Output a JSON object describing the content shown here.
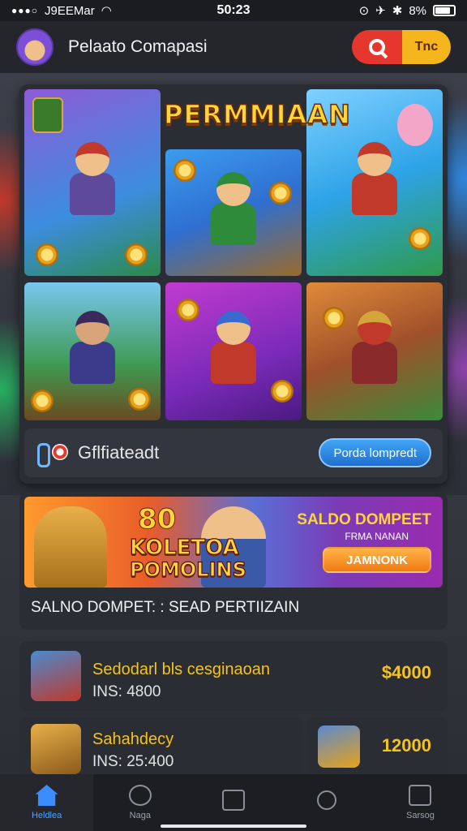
{
  "status_bar": {
    "carrier": "J9EEMar",
    "time": "50:23",
    "battery": "8%"
  },
  "header": {
    "title": "Pelaato Comapasi",
    "tab_label": "Tnc",
    "search_icon": "search-icon",
    "colors": {
      "search": "#e5372e",
      "tab": "#f5b51c"
    }
  },
  "games": {
    "banner_title": "PERMMIAAN",
    "tiles": [
      {
        "badge": ""
      },
      {
        "badge": ""
      },
      {
        "badge": ""
      },
      {
        "badge": ""
      },
      {
        "badge": ""
      },
      {
        "badge": ""
      }
    ],
    "name": "Gflfiateadt",
    "play_label": "Porda lompredt"
  },
  "promo": {
    "big_number": "80",
    "word_1": "KOLETOA",
    "word_2": "POMOLINS",
    "right_title": "SALDO DOMPEET",
    "right_subtitle": "FRMA NANAN",
    "cta_label": "JAMNONK",
    "caption": "SALNO DOMPET: : SEAD PERTIIZAIN"
  },
  "list": [
    {
      "title": "Sedodarl bls cesginaoan",
      "subtitle": "INS: 4800",
      "amount": "$4000"
    },
    {
      "title": "Sahahdecy",
      "subtitle": "INS: 25:400",
      "amount": "12000"
    }
  ],
  "bottom_nav": [
    {
      "label": "Heldlea",
      "icon": "home-icon",
      "active": true
    },
    {
      "label": "Naga",
      "icon": "medal-icon",
      "active": false
    },
    {
      "label": "",
      "icon": "bag-icon",
      "active": false
    },
    {
      "label": "",
      "icon": "search-icon",
      "active": false
    },
    {
      "label": "Sarsog",
      "icon": "shop-icon",
      "active": false
    }
  ]
}
